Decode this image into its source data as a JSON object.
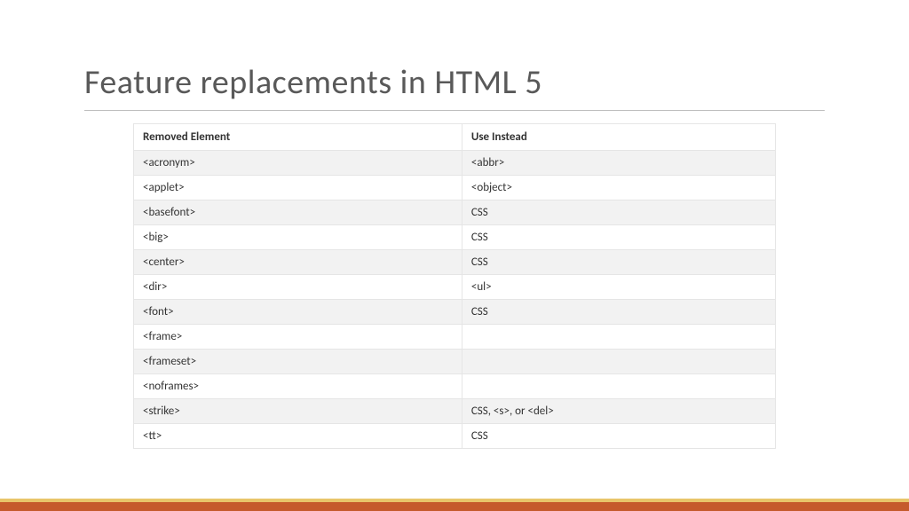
{
  "slide": {
    "title": "Feature replacements in HTML 5"
  },
  "table": {
    "headers": {
      "removed": "Removed Element",
      "instead": "Use Instead"
    },
    "rows": [
      {
        "removed": "<acronym>",
        "instead": "<abbr>"
      },
      {
        "removed": "<applet>",
        "instead": "<object>"
      },
      {
        "removed": "<basefont>",
        "instead": "CSS"
      },
      {
        "removed": "<big>",
        "instead": "CSS"
      },
      {
        "removed": "<center>",
        "instead": "CSS"
      },
      {
        "removed": "<dir>",
        "instead": "<ul>"
      },
      {
        "removed": "<font>",
        "instead": "CSS"
      },
      {
        "removed": "<frame>",
        "instead": ""
      },
      {
        "removed": "<frameset>",
        "instead": ""
      },
      {
        "removed": "<noframes>",
        "instead": ""
      },
      {
        "removed": "<strike>",
        "instead": "CSS, <s>, or <del>"
      },
      {
        "removed": "<tt>",
        "instead": "CSS"
      }
    ]
  },
  "colors": {
    "accent": "#c55a2c",
    "gold": "#e8c56a"
  }
}
